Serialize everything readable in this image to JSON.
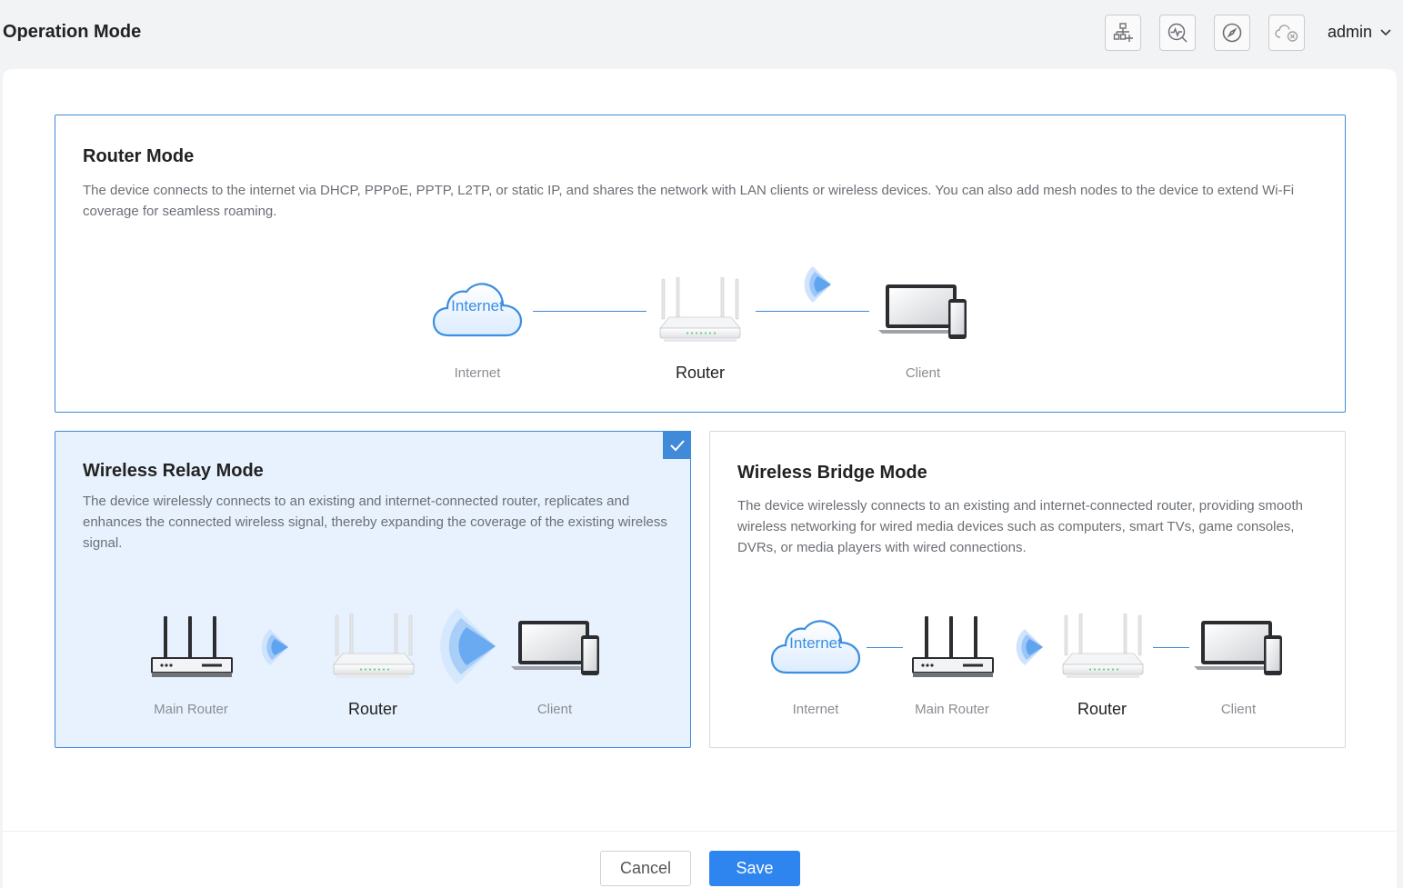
{
  "header": {
    "title": "Operation Mode",
    "tools": [
      {
        "icon": "network-add-icon"
      },
      {
        "icon": "diagnose-icon"
      },
      {
        "icon": "compass-icon"
      },
      {
        "icon": "cloud-disconnected-icon"
      }
    ],
    "user": "admin"
  },
  "modes": {
    "router": {
      "title": "Router Mode",
      "description": "The device connects to the internet via DHCP, PPPoE, PPTP, L2TP, or static IP, and shares the network with LAN clients or wireless devices. You can also add mesh nodes to the device to extend Wi-Fi coverage for seamless roaming.",
      "diagram": {
        "cloud_text": "Internet",
        "internet": "Internet",
        "router": "Router",
        "client": "Client"
      },
      "selected": false
    },
    "relay": {
      "title": "Wireless Relay Mode",
      "description": "The device wirelessly connects to an existing and internet-connected router, replicates and enhances the connected wireless signal, thereby expanding the coverage of the existing wireless signal.",
      "diagram": {
        "main_router": "Main Router",
        "router": "Router",
        "client": "Client"
      },
      "selected": true
    },
    "bridge": {
      "title": "Wireless Bridge Mode",
      "description": "The device wirelessly connects to an existing and internet-connected router, providing smooth wireless networking for wired media devices such as computers, smart TVs, game consoles, DVRs, or media players with wired connections.",
      "diagram": {
        "cloud_text": "Internet",
        "internet": "Internet",
        "main_router": "Main Router",
        "router": "Router",
        "client": "Client"
      },
      "selected": false
    }
  },
  "footer": {
    "cancel": "Cancel",
    "save": "Save"
  },
  "colors": {
    "accent": "#2f85f0",
    "selected_bg": "#e8f2fe",
    "border": "#3f8ad9"
  }
}
